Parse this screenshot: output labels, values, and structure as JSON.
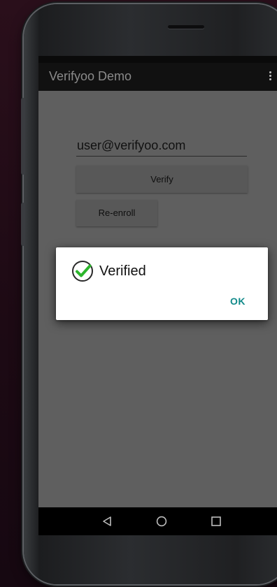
{
  "app": {
    "title": "Verifyoo Demo",
    "overflow_icon": "overflow-menu-icon"
  },
  "form": {
    "email_value": "user@verifyoo.com",
    "verify_label": "Verify",
    "reenroll_label": "Re-enroll"
  },
  "dialog": {
    "icon": "checkmark-circle-icon",
    "title": "Verified",
    "ok_label": "OK",
    "accent_color": "#118a8a",
    "check_color": "#2bb52b"
  },
  "nav": {
    "back_icon": "back-icon",
    "home_icon": "home-icon",
    "recents_icon": "recents-icon"
  }
}
